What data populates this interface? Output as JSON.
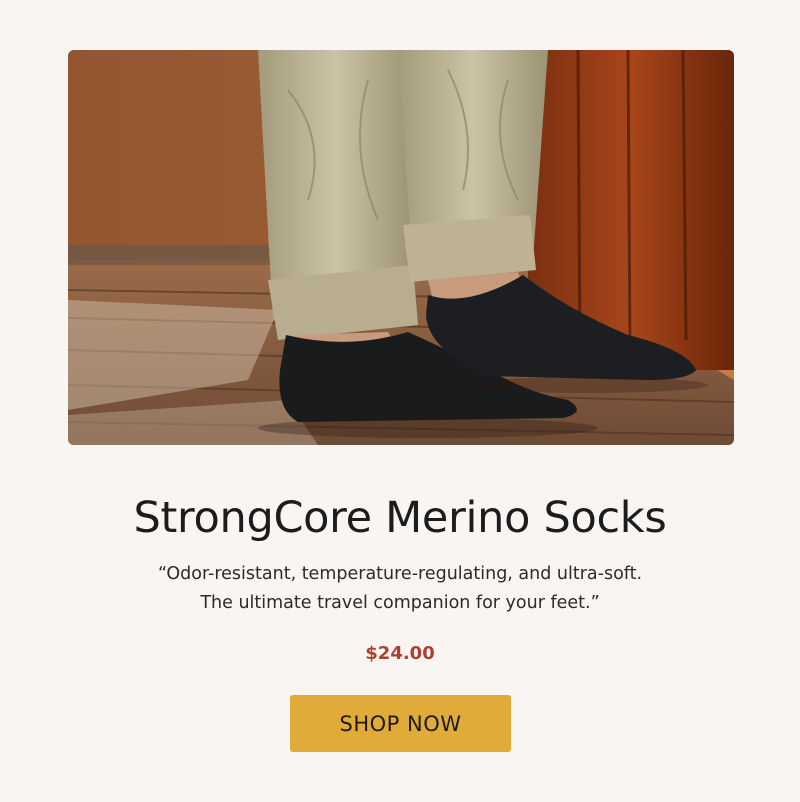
{
  "product": {
    "image_alt": "Person wearing black merino ankle socks and khaki cuffed pants on a sunlit wooden deck",
    "title": "StrongCore Merino Socks",
    "quote_line1": "“Odor-resistant, temperature-regulating, and ultra-soft.",
    "quote_line2": "The ultimate travel companion for your feet.”",
    "price": "$24.00"
  },
  "cta": {
    "label": "SHOP NOW"
  },
  "colors": {
    "background": "#f8f5f2",
    "price": "#b0402e",
    "button": "#e0ab38",
    "text": "#1c1c1c"
  }
}
